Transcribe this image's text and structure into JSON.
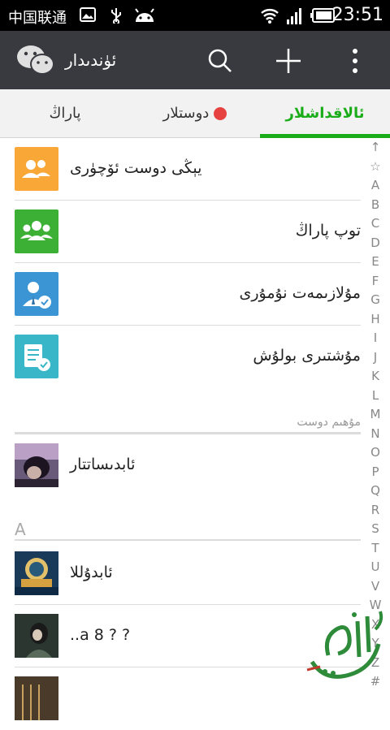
{
  "status_bar": {
    "carrier": "中国联通",
    "time": "23:51"
  },
  "app_bar": {
    "title": "ئۈندىدار",
    "icons": [
      "wechat-logo",
      "search-icon",
      "add-icon",
      "more-icon"
    ]
  },
  "tabs": [
    {
      "label": "پاراڭ",
      "active": false
    },
    {
      "label": "دوستلار",
      "active": false,
      "badge": "red-dot"
    },
    {
      "label": "ئالاقداشلار",
      "active": true
    }
  ],
  "functions": [
    {
      "label": "يېڭى دوست ئۆچۈرى",
      "icon": "add-friend-icon",
      "color": "#f9a837"
    },
    {
      "label": "توپ پاراڭ",
      "icon": "group-chat-icon",
      "color": "#3cb034"
    },
    {
      "label": "مۇلازىمەت نۇمۇرى",
      "icon": "official-account-icon",
      "color": "#3b95d4"
    },
    {
      "label": "مۇشتىرى بولۇش",
      "icon": "subscription-icon",
      "color": "#39b7c8"
    }
  ],
  "starred_header": "مۇھىم دوست",
  "starred": [
    {
      "name": "ئابدىساتتار"
    }
  ],
  "letter_header": "A",
  "contacts": [
    {
      "name": "ئابدۇللا"
    },
    {
      "name": "..a 8 ?  ?"
    }
  ],
  "index_letters": [
    "↑",
    "☆",
    "A",
    "B",
    "C",
    "D",
    "E",
    "F",
    "G",
    "H",
    "I",
    "J",
    "K",
    "L",
    "M",
    "N",
    "O",
    "P",
    "Q",
    "R",
    "S",
    "T",
    "U",
    "V",
    "W",
    "X",
    "Y",
    "Z",
    "#"
  ],
  "colors": {
    "appbar": "#393a3f",
    "accent": "#1aad19",
    "badge": "#e64340"
  }
}
